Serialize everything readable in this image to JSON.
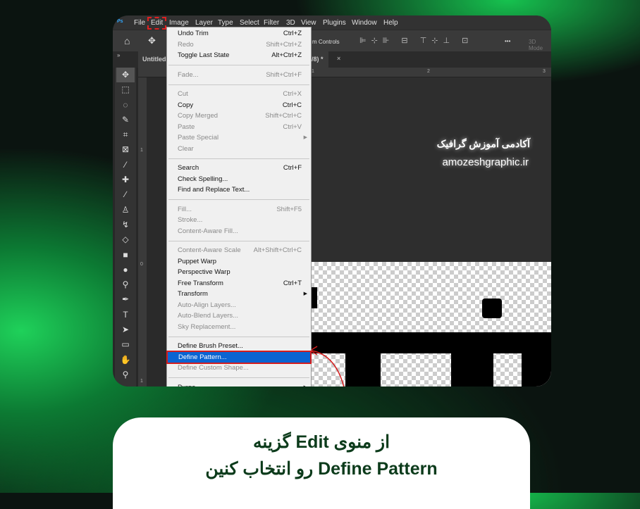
{
  "menubar": {
    "logo": "Ps",
    "items": [
      "File",
      "Edit",
      "Image",
      "Layer",
      "Type",
      "Select",
      "Filter",
      "3D",
      "View",
      "Plugins",
      "Window",
      "Help"
    ]
  },
  "options": {
    "transform_controls": "m Controls",
    "more": "•••",
    "mode": "3D Mode"
  },
  "tab": {
    "title": "Untitled",
    "suffix": "/8) *",
    "close": "×"
  },
  "ruler": {
    "h": [
      "1",
      "2",
      "3"
    ],
    "v": [
      "1",
      "0",
      "1"
    ]
  },
  "toolbar": {
    "icons": [
      "move-icon",
      "marquee-icon",
      "lasso-icon",
      "quick-select-icon",
      "crop-icon",
      "frame-icon",
      "eyedropper-icon",
      "healing-icon",
      "brush-icon",
      "stamp-icon",
      "history-brush-icon",
      "eraser-icon",
      "gradient-icon",
      "blur-icon",
      "dodge-icon",
      "pen-icon",
      "type-icon",
      "path-select-icon",
      "rectangle-icon",
      "hand-icon",
      "zoom-icon"
    ]
  },
  "canvas": {
    "title_fa": "آکادمی آموزش گرافیک",
    "url": "amozeshgraphic.ir"
  },
  "edit_menu": [
    {
      "label": "Undo Trim",
      "shortcut": "Ctrl+Z"
    },
    {
      "label": "Redo",
      "shortcut": "Shift+Ctrl+Z",
      "disabled": true
    },
    {
      "label": "Toggle Last State",
      "shortcut": "Alt+Ctrl+Z"
    },
    {
      "sep": true
    },
    {
      "label": "Fade...",
      "shortcut": "Shift+Ctrl+F",
      "disabled": true
    },
    {
      "sep": true
    },
    {
      "label": "Cut",
      "shortcut": "Ctrl+X",
      "disabled": true
    },
    {
      "label": "Copy",
      "shortcut": "Ctrl+C"
    },
    {
      "label": "Copy Merged",
      "shortcut": "Shift+Ctrl+C",
      "disabled": true
    },
    {
      "label": "Paste",
      "shortcut": "Ctrl+V",
      "disabled": true
    },
    {
      "label": "Paste Special",
      "submenu": true,
      "disabled": true
    },
    {
      "label": "Clear",
      "disabled": true
    },
    {
      "sep": true
    },
    {
      "label": "Search",
      "shortcut": "Ctrl+F"
    },
    {
      "label": "Check Spelling..."
    },
    {
      "label": "Find and Replace Text..."
    },
    {
      "sep": true
    },
    {
      "label": "Fill...",
      "shortcut": "Shift+F5",
      "disabled": true
    },
    {
      "label": "Stroke...",
      "disabled": true
    },
    {
      "label": "Content-Aware Fill...",
      "disabled": true
    },
    {
      "sep": true
    },
    {
      "label": "Content-Aware Scale",
      "shortcut": "Alt+Shift+Ctrl+C",
      "disabled": true
    },
    {
      "label": "Puppet Warp"
    },
    {
      "label": "Perspective Warp"
    },
    {
      "label": "Free Transform",
      "shortcut": "Ctrl+T"
    },
    {
      "label": "Transform",
      "submenu": true
    },
    {
      "label": "Auto-Align Layers...",
      "disabled": true
    },
    {
      "label": "Auto-Blend Layers...",
      "disabled": true
    },
    {
      "label": "Sky Replacement...",
      "disabled": true
    },
    {
      "sep": true
    },
    {
      "label": "Define Brush Preset..."
    },
    {
      "label": "Define Pattern...",
      "highlighted": true
    },
    {
      "label": "Define Custom Shape...",
      "disabled": true
    },
    {
      "sep": true
    },
    {
      "label": "Purge",
      "submenu": true
    }
  ],
  "caption": {
    "line1": "از منوی Edit گزینه",
    "line2": "Define Pattern رو انتخاب کنین"
  },
  "colors": {
    "accent_green": "#1fd15a",
    "highlight_blue": "#0a64d2",
    "annotation_red": "#d51d1d",
    "caption_text": "#0c3b1b"
  }
}
